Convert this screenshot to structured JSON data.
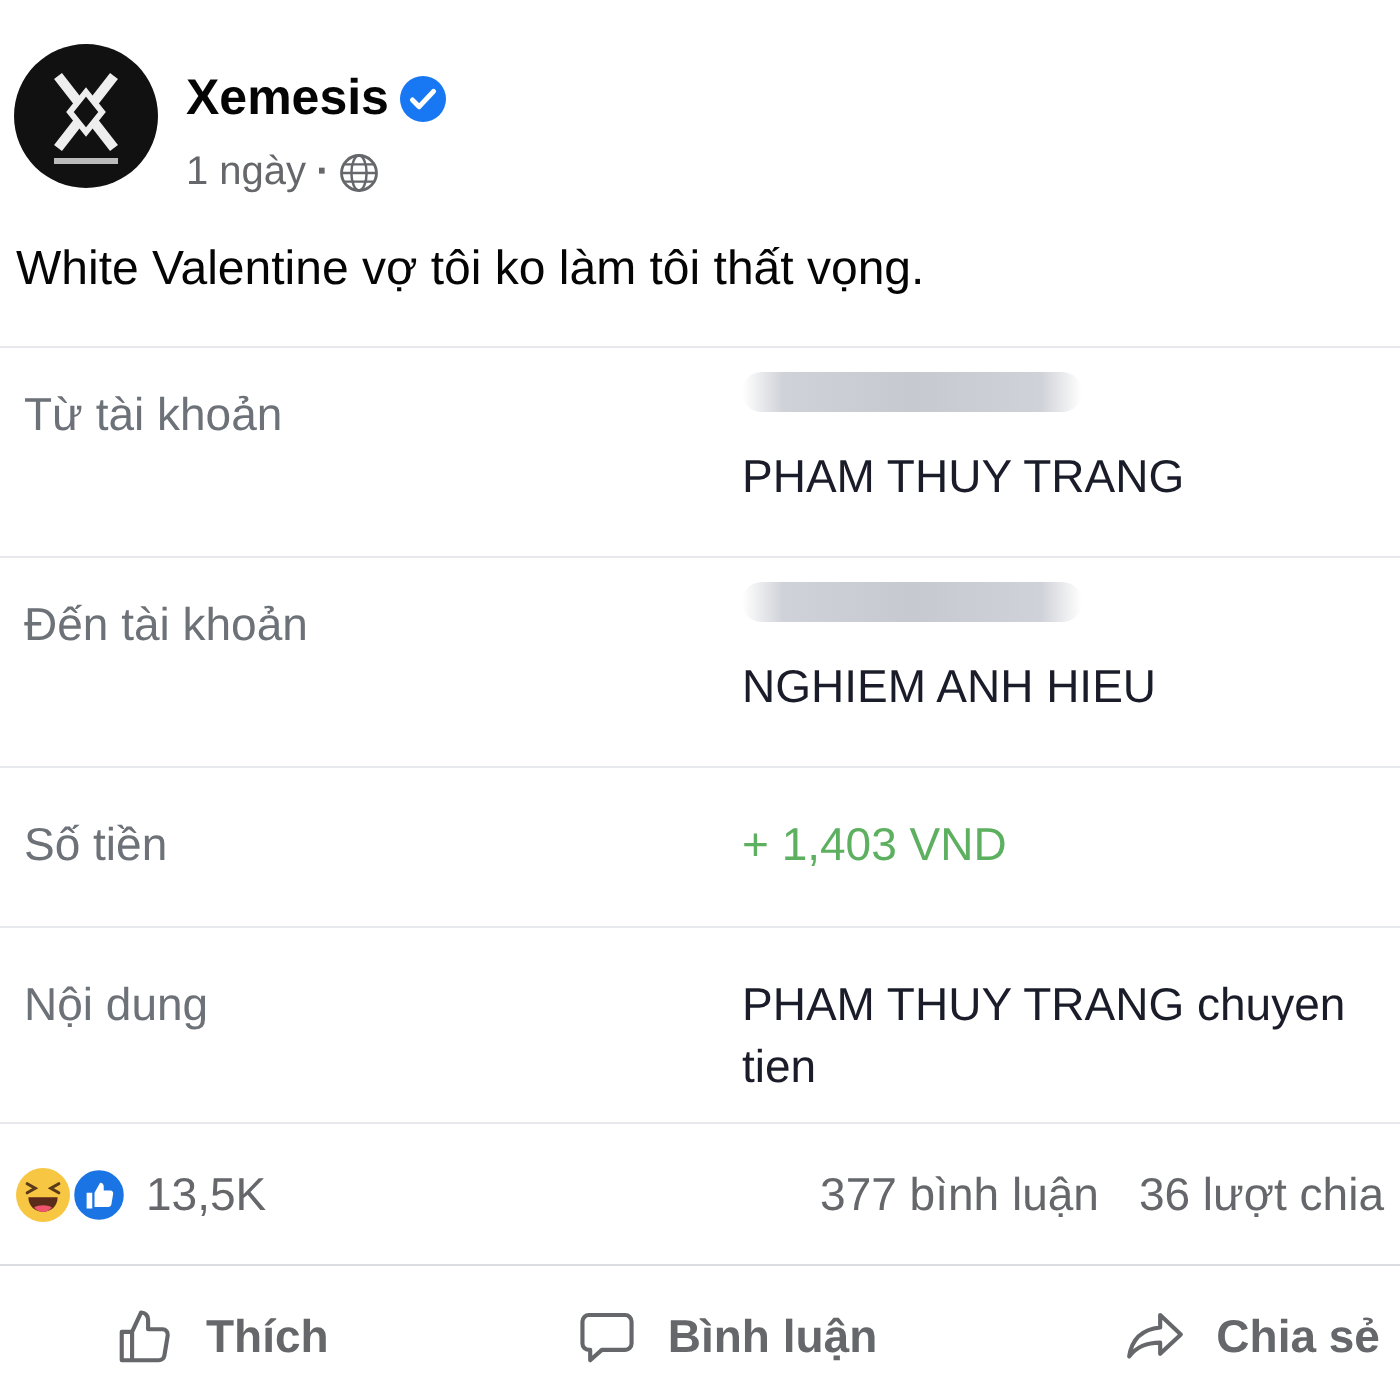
{
  "post": {
    "author": {
      "name": "Xemesis",
      "verified": true
    },
    "time": "1 ngày",
    "time_separator": "·",
    "text": "White Valentine vợ tôi ko làm tôi thất vọng."
  },
  "receipt": {
    "rows": [
      {
        "kind": "account",
        "label": "Từ tài khoản",
        "value": "PHAM THUY TRANG"
      },
      {
        "kind": "account",
        "label": "Đến tài khoản",
        "value": "NGHIEM ANH HIEU"
      },
      {
        "kind": "amount",
        "label": "Số tiền",
        "value": "+ 1,403 VND"
      },
      {
        "kind": "text",
        "label": "Nội dung",
        "value": "PHAM THUY TRANG chuyen tien"
      }
    ]
  },
  "reactions": {
    "count": "13,5K",
    "comments": "377 bình luận",
    "shares": "36 lượt chia"
  },
  "actions": [
    {
      "kind": "like",
      "label": "Thích"
    },
    {
      "kind": "comment",
      "label": "Bình luận"
    },
    {
      "kind": "share",
      "label": "Chia sẻ"
    }
  ]
}
